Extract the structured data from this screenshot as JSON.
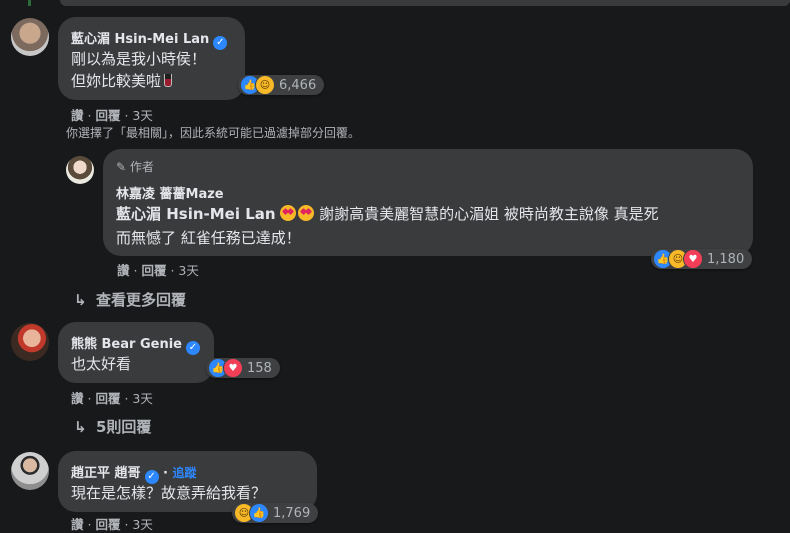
{
  "comments": [
    {
      "author": "藍心湄 Hsin-Mei Lan",
      "text_lines": [
        "剛以為是我小時侯！",
        "但妳比較美啦"
      ],
      "reactions": {
        "icons": [
          "like-icon",
          "haha-icon"
        ],
        "count": "6,466"
      },
      "actions": {
        "like": "讚",
        "reply": "回覆",
        "time": "3天"
      },
      "filter_notice": "你選擇了「最相關」，因此系統可能已過濾掉部分回覆。"
    },
    {
      "author_badge": "作者",
      "author": "林嘉凌 薔薔Maze",
      "mention": "藍心湄 Hsin-Mei Lan",
      "text_line1_rest": "謝謝高貴美麗智慧的心湄姐 被時尚教主說像 真是死",
      "text_line2": "而無憾了 紅雀任務已達成！",
      "reactions": {
        "icons": [
          "like-icon",
          "haha-icon",
          "love-icon"
        ],
        "count": "1,180"
      },
      "actions": {
        "like": "讚",
        "reply": "回覆",
        "time": "3天"
      }
    },
    {
      "view_more": "查看更多回覆"
    },
    {
      "author": "熊熊 Bear Genie",
      "text_lines": [
        "也太好看"
      ],
      "reactions": {
        "icons": [
          "like-icon",
          "love-icon"
        ],
        "count": "158"
      },
      "actions": {
        "like": "讚",
        "reply": "回覆",
        "time": "3天"
      },
      "replies_link": "5則回覆"
    },
    {
      "author": "趙正平 趙哥",
      "follow": "追蹤",
      "text_lines": [
        "現在是怎樣？故意弄給我看？"
      ],
      "reactions": {
        "icons": [
          "haha-icon",
          "like-icon"
        ],
        "count": "1,769"
      },
      "actions": {
        "like": "讚",
        "reply": "回覆",
        "time": "3天"
      }
    }
  ],
  "colors": {
    "background": "#18191a",
    "bubble": "#3a3b3c",
    "link": "#2d88ff",
    "muted": "#b0b3b8"
  }
}
